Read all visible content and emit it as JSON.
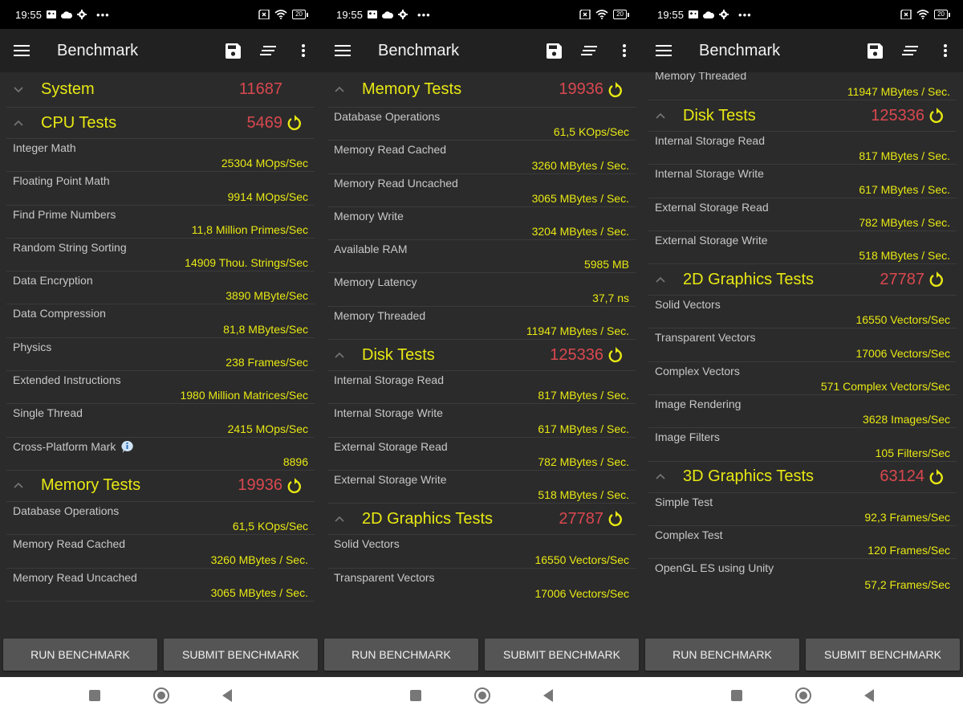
{
  "status_bar": {
    "time": "19:55",
    "battery": "20"
  },
  "toolbar": {
    "title": "Benchmark",
    "menu_icon": "hamburger-menu-icon",
    "save_icon": "floppy-disk-icon",
    "sort_icon": "sort-lines-icon",
    "more_icon": "more-vert-icon"
  },
  "buttons": {
    "run": "RUN BENCHMARK",
    "submit": "SUBMIT BENCHMARK"
  },
  "colors": {
    "group_name": "#e8e814",
    "score": "#d9484f",
    "item_value": "#e8e814",
    "item_name": "#c8c8c8",
    "background": "#2b2b2b",
    "toolbar": "#212121"
  },
  "screens": [
    {
      "system": {
        "name": "System",
        "score": "11687"
      },
      "cpu": {
        "name": "CPU Tests",
        "score": "5469",
        "items": [
          {
            "name": "Integer Math",
            "value": "25304 MOps/Sec"
          },
          {
            "name": "Floating Point Math",
            "value": "9914 MOps/Sec"
          },
          {
            "name": "Find Prime Numbers",
            "value": "11,8 Million Primes/Sec"
          },
          {
            "name": "Random String Sorting",
            "value": "14909 Thou. Strings/Sec"
          },
          {
            "name": "Data Encryption",
            "value": "3890 MByte/Sec"
          },
          {
            "name": "Data Compression",
            "value": "81,8 MBytes/Sec"
          },
          {
            "name": "Physics",
            "value": "238 Frames/Sec"
          },
          {
            "name": "Extended Instructions",
            "value": "1980 Million Matrices/Sec"
          },
          {
            "name": "Single Thread",
            "value": "2415 MOps/Sec"
          },
          {
            "name": "Cross-Platform Mark",
            "value": "8896"
          }
        ]
      },
      "memory": {
        "name": "Memory Tests",
        "score": "19936",
        "items": [
          {
            "name": "Database Operations",
            "value": "61,5 KOps/Sec"
          },
          {
            "name": "Memory Read Cached",
            "value": "3260 MBytes / Sec."
          },
          {
            "name": "Memory Read Uncached",
            "value": "3065 MBytes / Sec."
          }
        ]
      }
    },
    {
      "memory": {
        "name": "Memory Tests",
        "score": "19936",
        "items": [
          {
            "name": "Database Operations",
            "value": "61,5 KOps/Sec"
          },
          {
            "name": "Memory Read Cached",
            "value": "3260 MBytes / Sec."
          },
          {
            "name": "Memory Read Uncached",
            "value": "3065 MBytes / Sec."
          },
          {
            "name": "Memory Write",
            "value": "3204 MBytes / Sec."
          },
          {
            "name": "Available RAM",
            "value": "5985 MB"
          },
          {
            "name": "Memory Latency",
            "value": "37,7 ns"
          },
          {
            "name": "Memory Threaded",
            "value": "11947 MBytes / Sec."
          }
        ]
      },
      "disk": {
        "name": "Disk Tests",
        "score": "125336",
        "items": [
          {
            "name": "Internal Storage Read",
            "value": "817 MBytes / Sec."
          },
          {
            "name": "Internal Storage Write",
            "value": "617 MBytes / Sec."
          },
          {
            "name": "External Storage Read",
            "value": "782 MBytes / Sec."
          },
          {
            "name": "External Storage Write",
            "value": "518 MBytes / Sec."
          }
        ]
      },
      "graphics2d": {
        "name": "2D Graphics Tests",
        "score": "27787",
        "items": [
          {
            "name": "Solid Vectors",
            "value": "16550 Vectors/Sec"
          },
          {
            "name": "Transparent Vectors",
            "value": "17006 Vectors/Sec"
          }
        ]
      }
    },
    {
      "memory_tail": {
        "name": "Memory Threaded",
        "value": "11947 MBytes / Sec."
      },
      "disk": {
        "name": "Disk Tests",
        "score": "125336",
        "items": [
          {
            "name": "Internal Storage Read",
            "value": "817 MBytes / Sec."
          },
          {
            "name": "Internal Storage Write",
            "value": "617 MBytes / Sec."
          },
          {
            "name": "External Storage Read",
            "value": "782 MBytes / Sec."
          },
          {
            "name": "External Storage Write",
            "value": "518 MBytes / Sec."
          }
        ]
      },
      "graphics2d": {
        "name": "2D Graphics Tests",
        "score": "27787",
        "items": [
          {
            "name": "Solid Vectors",
            "value": "16550 Vectors/Sec"
          },
          {
            "name": "Transparent Vectors",
            "value": "17006 Vectors/Sec"
          },
          {
            "name": "Complex Vectors",
            "value": "571 Complex Vectors/Sec"
          },
          {
            "name": "Image Rendering",
            "value": "3628 Images/Sec"
          },
          {
            "name": "Image Filters",
            "value": "105 Filters/Sec"
          }
        ]
      },
      "graphics3d": {
        "name": "3D Graphics Tests",
        "score": "63124",
        "items": [
          {
            "name": "Simple Test",
            "value": "92,3 Frames/Sec"
          },
          {
            "name": "Complex Test",
            "value": "120 Frames/Sec"
          },
          {
            "name": "OpenGL ES using Unity",
            "value": "57,2 Frames/Sec"
          }
        ]
      }
    }
  ]
}
